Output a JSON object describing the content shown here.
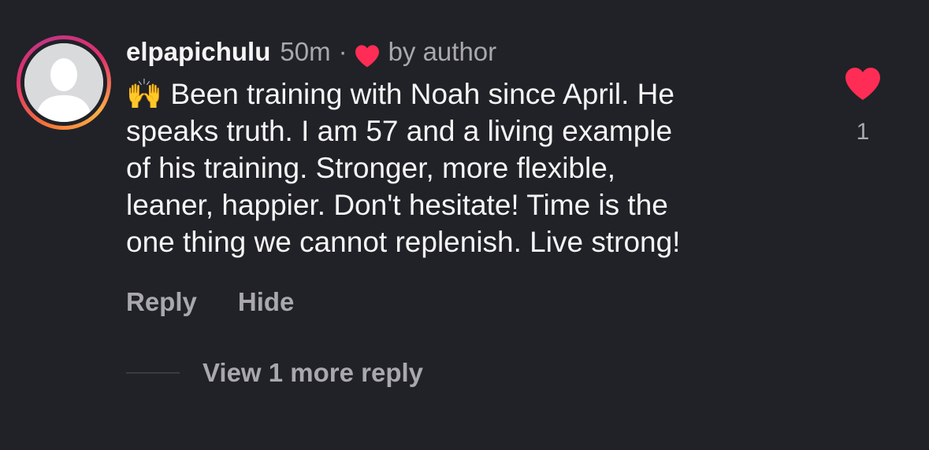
{
  "comment": {
    "username": "elpapichulu",
    "timestamp": "50m",
    "separator": "·",
    "author_like_label": "by author",
    "emoji": "🙌",
    "text": "Been training with Noah since April.  He\nspeaks truth.  I am 57 and a living example\nof his training. Stronger, more flexible,\nleaner, happier.  Don't hesitate!  Time is the\none thing we cannot replenish.  Live strong!",
    "like_count": "1",
    "liked": true
  },
  "actions": {
    "reply_label": "Reply",
    "hide_label": "Hide"
  },
  "replies": {
    "view_more_label": "View 1 more reply"
  },
  "icons": {
    "avatar": "default-person-avatar",
    "author_heart": "heart-icon",
    "like_heart": "heart-icon"
  },
  "colors": {
    "background": "#202227",
    "heart": "#ff2d55",
    "muted_text": "#a8a8ad",
    "primary_text": "#f5f5f5"
  }
}
